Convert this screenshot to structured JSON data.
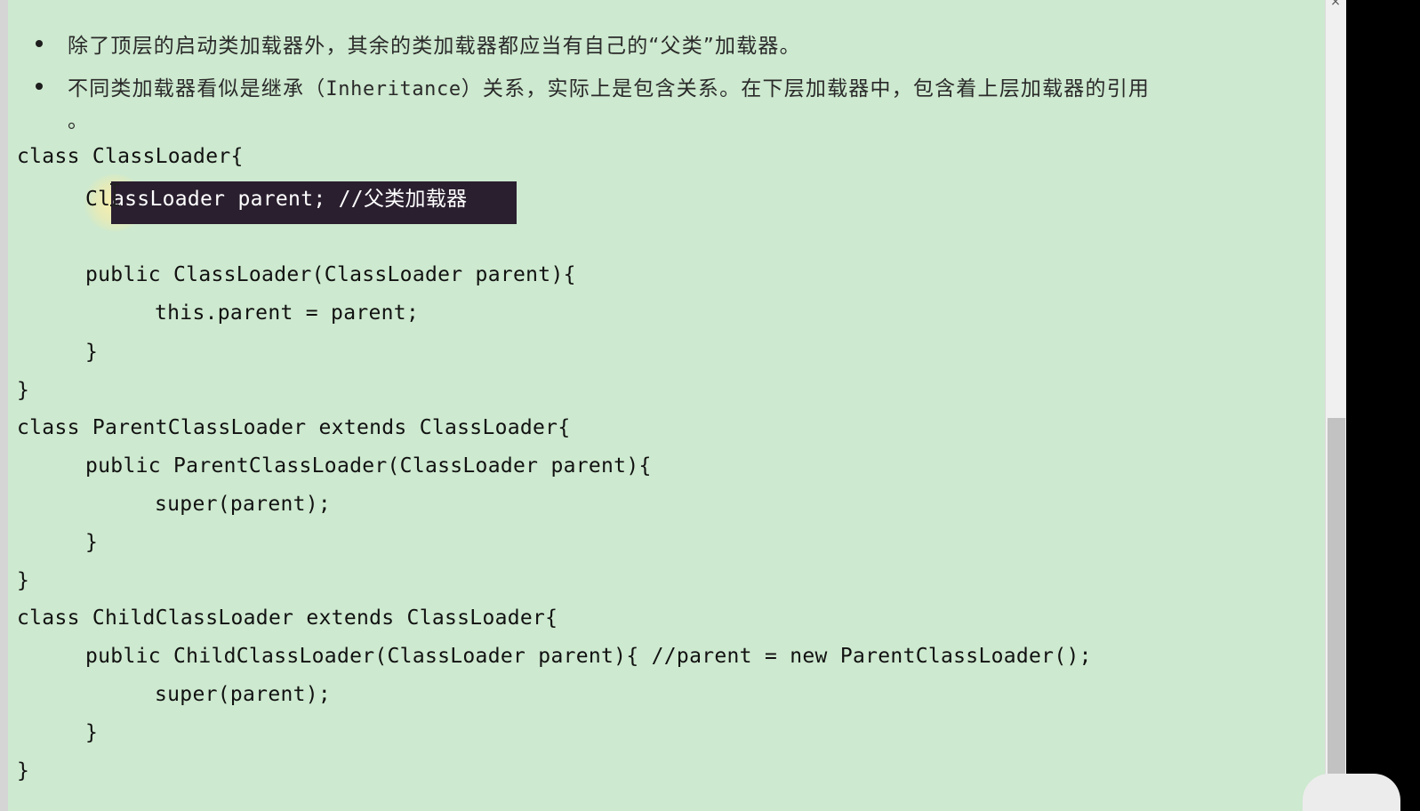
{
  "bullets": [
    {
      "text": "除了顶层的启动类加载器外，其余的类加载器都应当有自己的“父类”加载器。"
    },
    {
      "pre": "不同类加载器看似是继承（",
      "mono": "Inheritance",
      "post": "）关系，实际上是包含关系。在下层加载器中，包含着上层加载器的引用",
      "cont": "。"
    }
  ],
  "code": {
    "line1": "class ClassLoader{",
    "line2_pre": "Cl",
    "line2_selected": "assLoader parent; //父类加载器",
    "line4": "public ClassLoader(ClassLoader parent){",
    "line5": "this.parent = parent;",
    "line6": "}",
    "line7": "}",
    "line8": "class ParentClassLoader extends ClassLoader{",
    "line9": "public ParentClassLoader(ClassLoader parent){",
    "line10": "super(parent);",
    "line11": "}",
    "line12": "}",
    "line13": "class ChildClassLoader extends ClassLoader{",
    "line14": "public ChildClassLoader(ClassLoader parent){ //parent = new ParentClassLoader();",
    "line15": "super(parent);",
    "line16": "}",
    "line17": "}"
  },
  "window": {
    "close_glyph": "×"
  }
}
